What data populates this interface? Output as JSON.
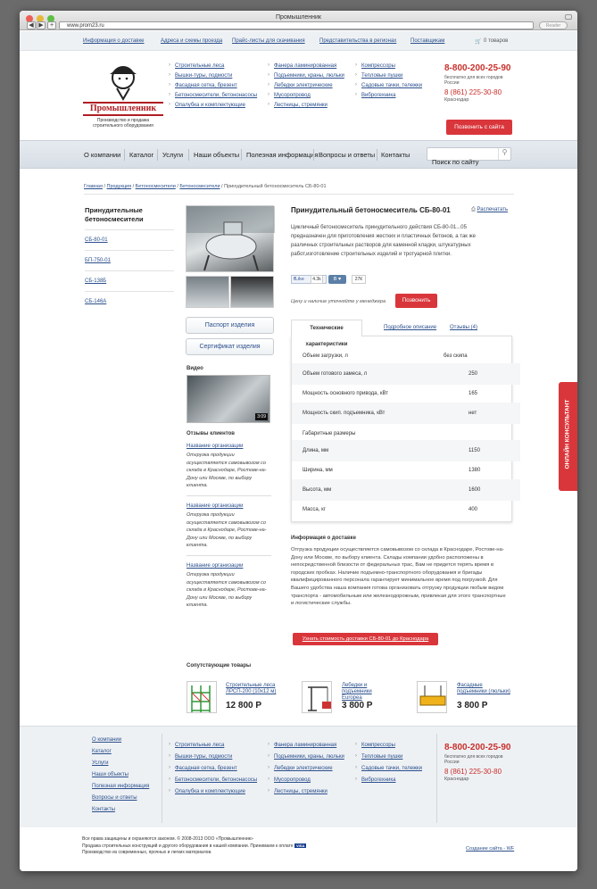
{
  "browser": {
    "title": "Промышленник",
    "url": "www.prom23.ru",
    "reader": "Reader",
    "back": "◀",
    "forward": "▶",
    "add": "+"
  },
  "top_nav": {
    "items": [
      "Информация о доставке",
      "Адреса и схемы проезда",
      "Прайс-листы для скачивания",
      "Представительства в регионах",
      "Поставщикам"
    ],
    "cart": "0 товаров"
  },
  "logo": {
    "name": "Промышленник",
    "tagline": "Производство и продажа строительного оборудования"
  },
  "catalog_columns": [
    [
      "Строительные леса",
      "Вышки-туры, подмости",
      "Фасадная сетка, брезент",
      "Бетоносмесители, бетононасосы",
      "Опалубка и комплектующие"
    ],
    [
      "Фанера ламинированная",
      "Подъемники, краны, люльки",
      "Лебедки электрические",
      "Мусоропровод",
      "Лестницы, стремянки"
    ],
    [
      "Компрессоры",
      "Тепловые пушки",
      "Садовые тачки, тележки",
      "Виброгехника"
    ]
  ],
  "contact": {
    "phone1": "8-800-200-25-90",
    "phone1_note": "бесплатно для всех городов России",
    "phone2": "8 (861) 225-30-80",
    "city": "Краснодар",
    "call_button": "Позвонить с сайта"
  },
  "main_nav": [
    "О компании",
    "Каталог",
    "Услуги",
    "Наши объекты",
    "Полезная информация",
    "Вопросы и ответы",
    "Контакты"
  ],
  "search": {
    "placeholder": "Поиск по сайту"
  },
  "breadcrumb": [
    "Главная",
    "Продукция",
    "Бетоносмесители",
    "Бетоносмесители",
    "Принудительный бетоносмеситель СБ-80-01"
  ],
  "sidebar": {
    "title": "Принудительные бетоносмесители",
    "items": [
      "СБ-80-01",
      "БП-750-01",
      "СБ-138Б",
      "СБ-146А"
    ]
  },
  "product": {
    "title": "Принудительный бетоносмеситель СБ-80-01",
    "print": "Распечатать",
    "description": "Цикличный бетоносмеситель принудительного действия СБ-80-01...05 предназначен для приготовления жестких и пластичных бетонов, а так же различных строительных растворов для каменной кладки, штукатурных работ,изготовление строительных изделий и тротуарной плитки.",
    "social": {
      "fb_like": "Like",
      "fb_count": "4.3k",
      "vk": "В",
      "vk_count": "27К"
    },
    "price_note": "Цену и наличие уточняйте у менеджера",
    "call_button": "Позвонить",
    "passport_button": "Паспорт изделия",
    "certificate_button": "Сертификат изделия",
    "video_label": "Видео",
    "video_time": "3:09"
  },
  "tabs": [
    "Технические характеристики",
    "Подробное описание",
    "Отзывы (4)"
  ],
  "specs": [
    {
      "name": "Объем загрузки, л",
      "value": "без скипа"
    },
    {
      "name": "Объем готового замеса, л",
      "value": "250"
    },
    {
      "name": "Мощность основного привода, кВт",
      "value": "165"
    },
    {
      "name": "Мощность скип. подъемника, кВт",
      "value": "нет"
    }
  ],
  "dims_title": "Габаритные размеры",
  "dims": [
    {
      "name": "Длина, мм",
      "value": "1150"
    },
    {
      "name": "Ширина, мм",
      "value": "1380"
    },
    {
      "name": "Высота, мм",
      "value": "1600"
    },
    {
      "name": "Масса, кг",
      "value": "400"
    }
  ],
  "reviews": {
    "title": "Отзывы клиентов",
    "items": [
      {
        "org": "Название организации",
        "text": "Отгрузка продукции осуществляется самовывозом со склада в Краснодаре, Ростове-на-Дону или Москве, по выбору клиента."
      },
      {
        "org": "Название организации",
        "text": "Отгрузка продукции осуществляется самовывозом со склада в Краснодаре, Ростове-на-Дону или Москве, по выбору клиента."
      },
      {
        "org": "Название организации",
        "text": "Отгрузка продукции осуществляется самовывозом со склада в Краснодаре, Ростове-на-Дону или Москве, по выбору клиента."
      }
    ]
  },
  "delivery": {
    "title": "Информация о доставке",
    "text": "Отгрузка продукции осуществляется самовывозом со склада в Краснодаре, Ростове-на-Дону или Москве, по выбору клиента. Склады компании удобно расположены в непосредственной близости от федеральных трас, Вам не придется терять время в городских пробках. Наличие подъемно-транспортного оборудования и бригады квалифицированного персонала гарантирует минимальное время под погрузкой. Для Вашего удобства наша компания готова организовать отгрузку продукции любым видом транспорта - автомобильным или железнодорожным, привлекая для этого транспортные и логистические службы.",
    "button": "Узнать стоимость доставки СБ-80-01 до Краснодара"
  },
  "related": {
    "title": "Сопутствующие товары",
    "items": [
      {
        "name": "Строительные леса ЛРСП-200 (10x12 м)",
        "price": "12 800 Р"
      },
      {
        "name": "Лебедки и подъемники Europea",
        "price": "3 800 Р"
      },
      {
        "name": "Фасадные подъемники (люльки)",
        "price": "3 800 Р"
      }
    ]
  },
  "consultant_tab": "ОНЛАЙН КОНСУЛЬТАНТ",
  "footer_nav": [
    "О компании",
    "Каталог",
    "Услуги",
    "Наши объекты",
    "Полезная информация",
    "Вопросы и ответы",
    "Контакты"
  ],
  "footer_bottom": {
    "copyright": "Все права защищены и охраняются законом. © 2008-2013 ООО «Промышленник»",
    "line2": "Продажа строительных конструкций и другого оборудования в нашей компании. Принимаем к оплате",
    "visa": "VISA",
    "line3": "Производство из современных, прочных и легких материалов.",
    "creator": "Создание сайта - WF"
  },
  "colors": {
    "accent_red": "#d9363b",
    "link_blue": "#2b4f8c",
    "nav_bg": "#dfe5eb"
  }
}
